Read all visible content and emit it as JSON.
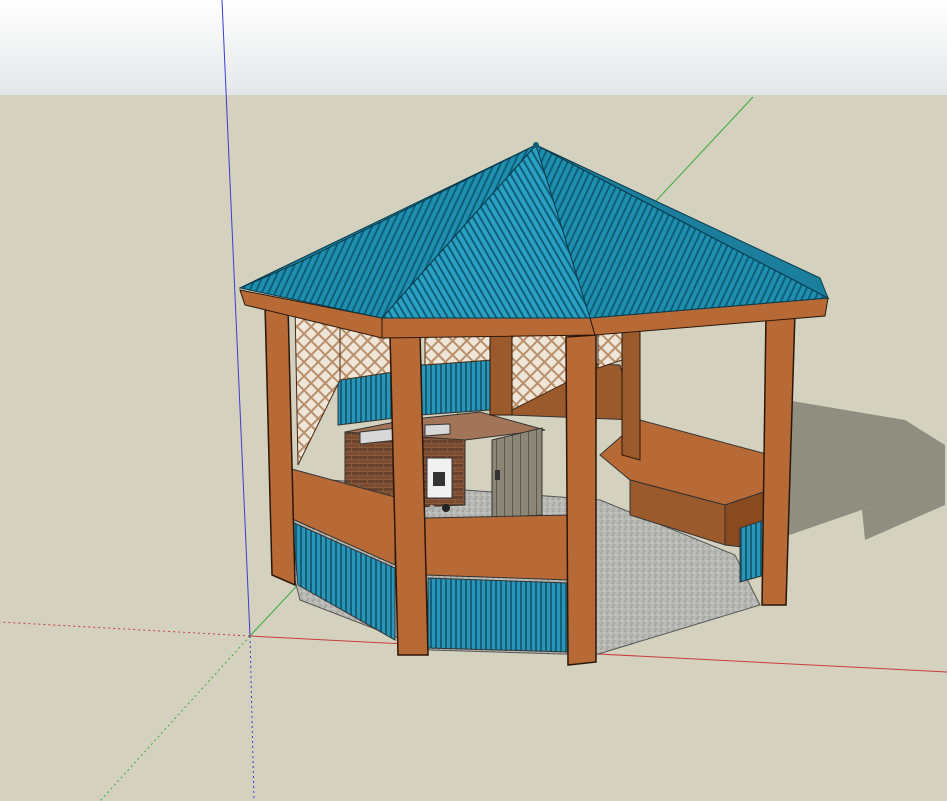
{
  "viewport": {
    "sky_color": "#e3e7e9",
    "sky_top_color": "#ffffff",
    "ground_color": "#d4d2bf"
  },
  "axes": {
    "red_color": "#c83c3c",
    "green_color": "#3aa83a",
    "blue_color": "#3c3cd0"
  },
  "model": {
    "roof_color": "#1f8fb0",
    "roof_stripe_color": "#0f5e78",
    "timber_color": "#b86a36",
    "timber_dark_color": "#8a4a20",
    "wall_panel_color": "#2796b8",
    "lattice_color": "#c9a98a",
    "brick_color": "#8a5a3c",
    "floor_color": "#b8b8b4",
    "shadow_color": "#8f8e80"
  },
  "icons": {
    "oven_door": "oven-door-icon",
    "wooden_door": "wooden-door-icon"
  }
}
